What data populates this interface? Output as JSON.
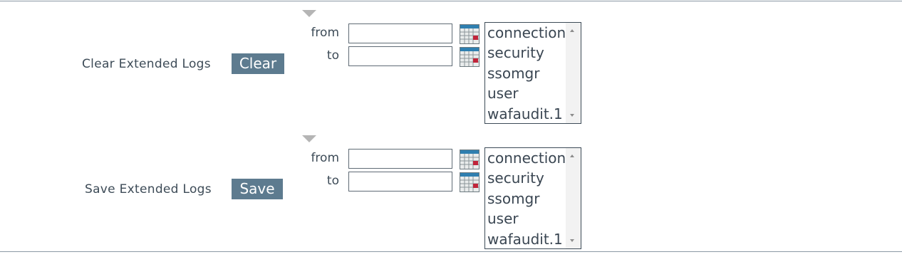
{
  "clear_section": {
    "label": "Clear Extended Logs",
    "button_label": "Clear",
    "from_label": "from",
    "to_label": "to",
    "from_value": "",
    "to_value": "",
    "log_types": [
      "connection",
      "security",
      "ssomgr",
      "user",
      "wafaudit.1"
    ]
  },
  "save_section": {
    "label": "Save Extended Logs",
    "button_label": "Save",
    "from_label": "from",
    "to_label": "to",
    "from_value": "",
    "to_value": "",
    "log_types": [
      "connection",
      "security",
      "ssomgr",
      "user",
      "wafaudit.1"
    ]
  },
  "colors": {
    "button_bg": "#5d7b8f",
    "text": "#3d4b57",
    "divider": "#8a98a4"
  },
  "icons": {
    "toggle": "triangle-down-icon",
    "calendar": "calendar-icon"
  }
}
